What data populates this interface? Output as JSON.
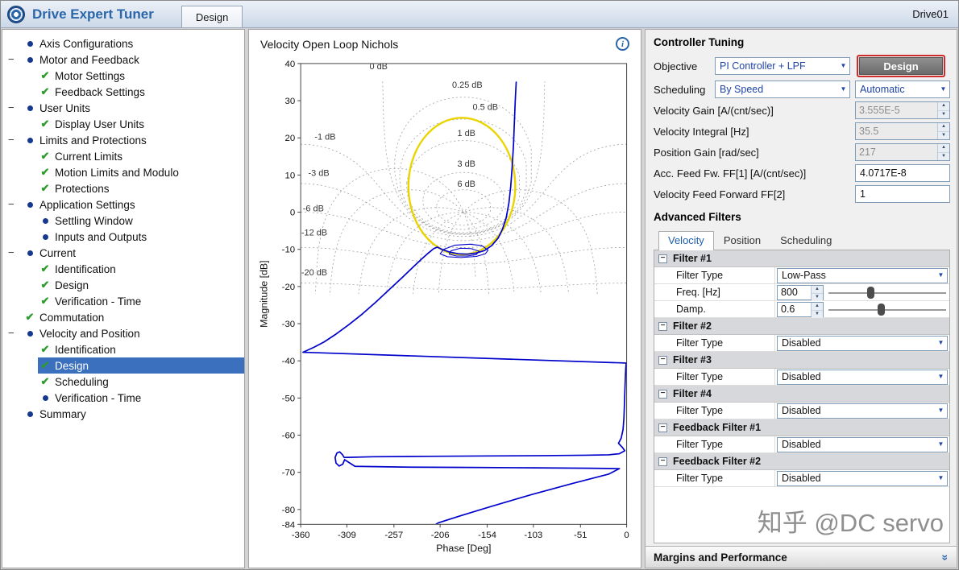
{
  "titlebar": {
    "app_title": "Drive Expert Tuner",
    "tab": "Design",
    "drive_name": "Drive01"
  },
  "nav": {
    "items": [
      {
        "label": "Axis Configurations",
        "level": 0,
        "icon": "bullet",
        "exp": false,
        "sel": false
      },
      {
        "label": "Motor and Feedback",
        "level": 0,
        "icon": "bullet",
        "exp": true,
        "sel": false
      },
      {
        "label": "Motor Settings",
        "level": 1,
        "icon": "check",
        "sel": false
      },
      {
        "label": "Feedback Settings",
        "level": 1,
        "icon": "check",
        "sel": false
      },
      {
        "label": "User Units",
        "level": 0,
        "icon": "bullet",
        "exp": true,
        "sel": false
      },
      {
        "label": "Display User Units",
        "level": 1,
        "icon": "check",
        "sel": false
      },
      {
        "label": "Limits and Protections",
        "level": 0,
        "icon": "bullet",
        "exp": true,
        "sel": false
      },
      {
        "label": "Current Limits",
        "level": 1,
        "icon": "check",
        "sel": false
      },
      {
        "label": "Motion Limits and Modulo",
        "level": 1,
        "icon": "check",
        "sel": false
      },
      {
        "label": "Protections",
        "level": 1,
        "icon": "check",
        "sel": false
      },
      {
        "label": "Application Settings",
        "level": 0,
        "icon": "bullet",
        "exp": true,
        "sel": false
      },
      {
        "label": "Settling Window",
        "level": 1,
        "icon": "bullet",
        "sel": false
      },
      {
        "label": "Inputs and Outputs",
        "level": 1,
        "icon": "bullet",
        "sel": false
      },
      {
        "label": "Current",
        "level": 0,
        "icon": "bullet",
        "exp": true,
        "sel": false
      },
      {
        "label": "Identification",
        "level": 1,
        "icon": "check",
        "sel": false
      },
      {
        "label": "Design",
        "level": 1,
        "icon": "check",
        "sel": false
      },
      {
        "label": "Verification - Time",
        "level": 1,
        "icon": "check",
        "sel": false
      },
      {
        "label": "Commutation",
        "level": 0,
        "icon": "check",
        "exp": false,
        "sel": false
      },
      {
        "label": "Velocity and Position",
        "level": 0,
        "icon": "bullet",
        "exp": true,
        "sel": false
      },
      {
        "label": "Identification",
        "level": 1,
        "icon": "check",
        "sel": false
      },
      {
        "label": "Design",
        "level": 1,
        "icon": "check",
        "sel": true
      },
      {
        "label": "Scheduling",
        "level": 1,
        "icon": "check",
        "sel": false
      },
      {
        "label": "Verification - Time",
        "level": 1,
        "icon": "bullet",
        "sel": false
      },
      {
        "label": "Summary",
        "level": 0,
        "icon": "bullet",
        "exp": false,
        "sel": false
      }
    ]
  },
  "chart": {
    "title": "Velocity Open Loop Nichols"
  },
  "chart_data": {
    "type": "line",
    "title": "Velocity Open Loop Nichols",
    "xlabel": "Phase [Deg]",
    "ylabel": "Magnitude [dB]",
    "xlim": [
      -360,
      0
    ],
    "ylim": [
      -84,
      40
    ],
    "xticks": [
      -360,
      -309,
      -257,
      -206,
      -154,
      -103,
      -51,
      0
    ],
    "yticks": [
      40,
      30,
      20,
      10,
      0,
      -10,
      -20,
      -30,
      -40,
      -50,
      -60,
      -70,
      -80,
      -84
    ],
    "grid": "nichols",
    "grid_m_db": [
      6,
      3,
      1,
      0.5,
      0.25,
      0,
      -1,
      -3,
      -6,
      -12,
      -20
    ],
    "grid_n_deg": [
      -30,
      -60,
      -90,
      -120,
      -150,
      -165,
      -195,
      -210,
      -240,
      -270,
      -300,
      -330
    ],
    "grid_min_db": -22,
    "grid_labels": [
      {
        "text": "0 dB",
        "phase": -274,
        "db": 38.5
      },
      {
        "text": "0.25 dB",
        "phase": -176,
        "db": 33.5
      },
      {
        "text": "0.5 dB",
        "phase": -156,
        "db": 27.5
      },
      {
        "text": "1 dB",
        "phase": -177,
        "db": 20.5
      },
      {
        "text": "3 dB",
        "phase": -177,
        "db": 12.2
      },
      {
        "text": "6 dB",
        "phase": -177,
        "db": 6.8
      },
      {
        "text": "-1 dB",
        "phase": -333,
        "db": 19.5
      },
      {
        "text": "-3 dB",
        "phase": -340,
        "db": 9.8
      },
      {
        "text": "-6 dB",
        "phase": -346,
        "db": 0.2
      },
      {
        "text": "-12 dB",
        "phase": -345,
        "db": -6.3
      },
      {
        "text": "-20 dB",
        "phase": -345,
        "db": -17
      }
    ],
    "curve_color": "#0000cc",
    "series": [
      {
        "name": "velocity-open-loop",
        "closed": false,
        "points": [
          [
            -122,
            35
          ],
          [
            -123,
            30
          ],
          [
            -124,
            24
          ],
          [
            -125,
            18
          ],
          [
            -126.5,
            12
          ],
          [
            -128,
            7
          ],
          [
            -130,
            2.5
          ],
          [
            -133,
            -1.5
          ],
          [
            -137,
            -4.5
          ],
          [
            -142,
            -7
          ],
          [
            -149,
            -9
          ],
          [
            -157,
            -10.3
          ],
          [
            -166,
            -11
          ],
          [
            -176,
            -11.3
          ],
          [
            -186,
            -11.2
          ],
          [
            -196,
            -10.7
          ],
          [
            -204,
            -10
          ],
          [
            -209,
            -9.4
          ],
          [
            -213,
            -9.8
          ],
          [
            -217,
            -10.6
          ],
          [
            -220,
            -11.2
          ],
          [
            -226,
            -12.5
          ],
          [
            -236,
            -14.8
          ],
          [
            -248,
            -17.6
          ],
          [
            -262,
            -20.8
          ],
          [
            -277,
            -24.2
          ],
          [
            -292,
            -27.4
          ],
          [
            -307,
            -30.3
          ],
          [
            -321,
            -32.8
          ],
          [
            -334,
            -34.9
          ],
          [
            -345,
            -36.3
          ],
          [
            -353,
            -37.2
          ],
          [
            -357.5,
            -37.7
          ],
          [
            -0.5,
            -40.6
          ],
          [
            -1,
            -42
          ],
          [
            -1.5,
            -45
          ],
          [
            -2,
            -48.5
          ],
          [
            -2.5,
            -52
          ],
          [
            -3,
            -55.5
          ],
          [
            -4,
            -58.5
          ],
          [
            -6,
            -60.8
          ],
          [
            -9,
            -62.2
          ],
          [
            -5,
            -63.2
          ],
          [
            -2,
            -64.2
          ],
          [
            -8,
            -65
          ],
          [
            -20,
            -65.3
          ],
          [
            -45,
            -65.4
          ],
          [
            -90,
            -65.5
          ],
          [
            -150,
            -65.6
          ],
          [
            -220,
            -65.7
          ],
          [
            -280,
            -65.8
          ],
          [
            -312,
            -66
          ],
          [
            -314,
            -65.2
          ],
          [
            -317,
            -64.5
          ],
          [
            -320,
            -64.8
          ],
          [
            -322,
            -66
          ],
          [
            -321,
            -67.5
          ],
          [
            -317.5,
            -68.3
          ],
          [
            -313.5,
            -67.8
          ],
          [
            -311.5,
            -66.6
          ],
          [
            -300,
            -68.4
          ],
          [
            -240,
            -68.6
          ],
          [
            -170,
            -68.7
          ],
          [
            -100,
            -68.8
          ],
          [
            -40,
            -68.9
          ],
          [
            -8,
            -69
          ],
          [
            -20,
            -70.5
          ],
          [
            -60,
            -73
          ],
          [
            -105,
            -76
          ],
          [
            -150,
            -79.2
          ],
          [
            -185,
            -81.8
          ],
          [
            -208,
            -83.6
          ],
          [
            -214,
            -84.5
          ]
        ]
      },
      {
        "name": "resonance-cluster-outer",
        "closed": true,
        "points": [
          [
            -153,
            -10.2
          ],
          [
            -160,
            -9.0
          ],
          [
            -173,
            -8.6
          ],
          [
            -190,
            -8.9
          ],
          [
            -202,
            -10.0
          ],
          [
            -206,
            -11.2
          ],
          [
            -198,
            -12.0
          ],
          [
            -183,
            -12.2
          ],
          [
            -166,
            -11.9
          ],
          [
            -156,
            -11.2
          ]
        ]
      },
      {
        "name": "resonance-cluster-inner",
        "closed": true,
        "points": [
          [
            -163,
            -10.5
          ],
          [
            -172,
            -9.8
          ],
          [
            -184,
            -9.7
          ],
          [
            -194,
            -10.4
          ],
          [
            -196,
            -11.3
          ],
          [
            -188,
            -11.8
          ],
          [
            -176,
            -11.8
          ],
          [
            -166,
            -11.4
          ]
        ]
      }
    ],
    "overlay_ellipse": {
      "name": "design-target-circle",
      "color": "#e9d400",
      "center": [
        -182,
        7
      ],
      "rx_deg": 59,
      "ry_db": 18.4
    }
  },
  "controller": {
    "header": "Controller Tuning",
    "objective": {
      "label": "Objective",
      "value": "PI Controller + LPF",
      "button": "Design"
    },
    "scheduling": {
      "label": "Scheduling",
      "value": "By Speed",
      "mode": "Automatic"
    },
    "params": [
      {
        "label": "Velocity Gain [A/(cnt/sec)]",
        "value": "3.555E-5",
        "disabled": true
      },
      {
        "label": "Velocity Integral [Hz]",
        "value": "35.5",
        "disabled": true
      },
      {
        "label": "Position Gain [rad/sec]",
        "value": "217",
        "disabled": true
      },
      {
        "label": "Acc. Feed Fw. FF[1] [A/(cnt/sec)]",
        "value": "4.0717E-8",
        "disabled": false
      },
      {
        "label": "Velocity Feed Forward FF[2]",
        "value": "1",
        "disabled": false
      }
    ]
  },
  "filters": {
    "header": "Advanced Filters",
    "tabs": [
      "Velocity",
      "Position",
      "Scheduling"
    ],
    "active_tab": "Velocity",
    "groups": [
      {
        "title": "Filter #1",
        "rows": [
          {
            "label": "Filter Type",
            "type": "dropdown",
            "value": "Low-Pass"
          },
          {
            "label": "Freq. [Hz]",
            "type": "spinner-slider",
            "name": "freq",
            "value": "800",
            "slider_pos": 0.33
          },
          {
            "label": "Damp.",
            "type": "spinner-slider",
            "name": "damp",
            "value": "0.6",
            "slider_pos": 0.42
          }
        ]
      },
      {
        "title": "Filter #2",
        "rows": [
          {
            "label": "Filter Type",
            "type": "dropdown",
            "value": "Disabled"
          }
        ]
      },
      {
        "title": "Filter #3",
        "rows": [
          {
            "label": "Filter Type",
            "type": "dropdown",
            "value": "Disabled"
          }
        ]
      },
      {
        "title": "Filter #4",
        "rows": [
          {
            "label": "Filter Type",
            "type": "dropdown",
            "value": "Disabled"
          }
        ]
      },
      {
        "title": "Feedback Filter #1",
        "rows": [
          {
            "label": "Filter Type",
            "type": "dropdown",
            "value": "Disabled"
          }
        ]
      },
      {
        "title": "Feedback Filter #2",
        "rows": [
          {
            "label": "Filter Type",
            "type": "dropdown",
            "value": "Disabled"
          }
        ]
      }
    ]
  },
  "margins_bar": {
    "label": "Margins and Performance"
  },
  "watermark": "知乎 @DC servo",
  "colors": {
    "accent": "#2a66a8",
    "selection": "#3a70bd",
    "check_green": "#2e9b2e",
    "curve_blue": "#0000cc",
    "target_yellow": "#e9d400",
    "highlight_red": "#cf2b2b"
  }
}
